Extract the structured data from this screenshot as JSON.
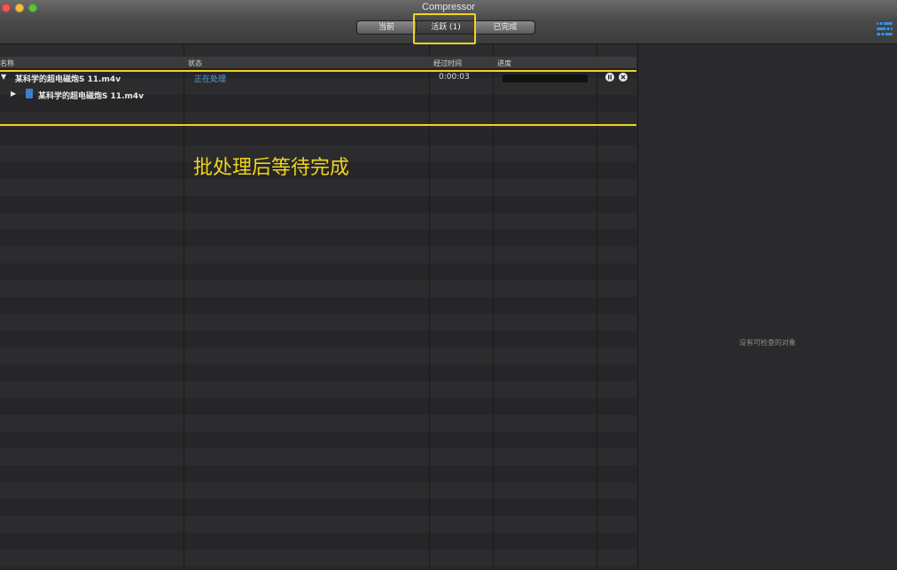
{
  "window": {
    "title": "Compressor",
    "tabs": [
      {
        "label": "当前"
      },
      {
        "label": "活跃 (1)"
      },
      {
        "label": "已完成"
      }
    ]
  },
  "columns": {
    "name": "名称",
    "status": "状态",
    "elapsed": "经过时间",
    "progress": "进度"
  },
  "jobs": [
    {
      "name": "某科学的超电磁炮S 11.m4v",
      "status": "正在处理",
      "elapsed": "0:00:03",
      "progress": 0.0,
      "child": {
        "name": "某科学的超电磁炮S 11.m4v"
      }
    }
  ],
  "annotation": {
    "text": "批处理后等待完成"
  },
  "inspector": {
    "empty_text": "没有可检查的对象"
  },
  "colors": {
    "annotation": "#f2d41e",
    "status": "#5a9fe0"
  },
  "icons": [
    "close-icon",
    "minimize-icon",
    "zoom-icon",
    "inspector-icon",
    "pause-icon",
    "cancel-icon",
    "disclosure-triangle-icon",
    "file-icon"
  ]
}
